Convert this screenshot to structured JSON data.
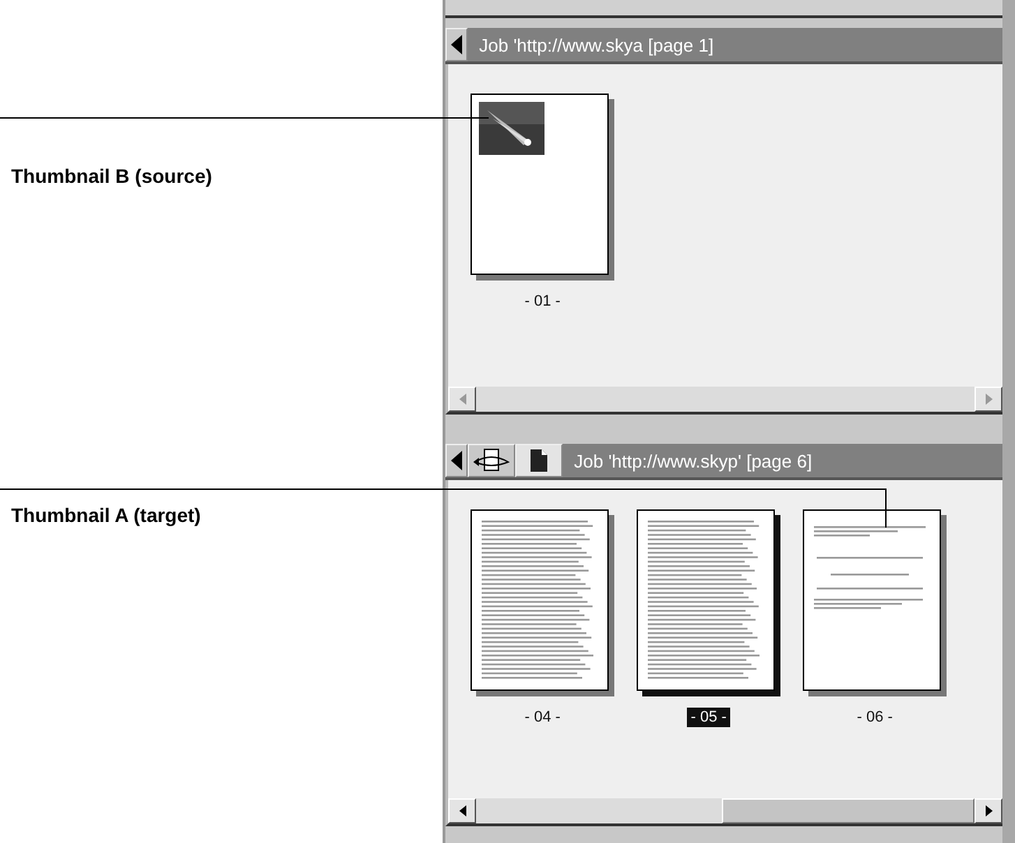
{
  "callouts": [
    {
      "label": "Thumbnail B (source)"
    },
    {
      "label": "Thumbnail A (target)"
    }
  ],
  "panels": [
    {
      "title": "Job 'http://www.skya  [page 1]",
      "tools": [
        {
          "kind": "back"
        }
      ],
      "thumbnails": [
        {
          "label": "- 01 -",
          "kind": "image-page",
          "selected": false
        }
      ]
    },
    {
      "title": "Job 'http://www.skyp' [page 6]",
      "tools": [
        {
          "kind": "back"
        },
        {
          "kind": "rotate"
        },
        {
          "kind": "page"
        }
      ],
      "thumbnails": [
        {
          "label": "- 04 -",
          "kind": "text-page",
          "selected": false
        },
        {
          "label": "- 05 -",
          "kind": "text-page",
          "selected": true
        },
        {
          "label": "- 06 -",
          "kind": "short-page",
          "selected": false
        }
      ]
    }
  ]
}
